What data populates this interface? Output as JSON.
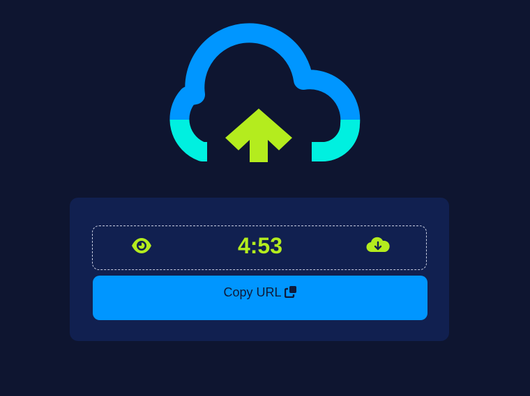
{
  "logo": {
    "icon": "cloud-upload-icon",
    "colors": {
      "cloud_top": "#0096ff",
      "cloud_bottom": "#00f0e0",
      "arrow": "#b4ec1e"
    }
  },
  "share_panel": {
    "timer": "4:53",
    "view_icon": "eye-icon",
    "download_icon": "cloud-download-icon",
    "copy_button": {
      "label": "Copy URL",
      "icon": "copy-icon"
    }
  },
  "colors": {
    "background": "#0e1530",
    "card": "#112050",
    "accent_green": "#b4ec1e",
    "accent_blue": "#0096ff"
  }
}
